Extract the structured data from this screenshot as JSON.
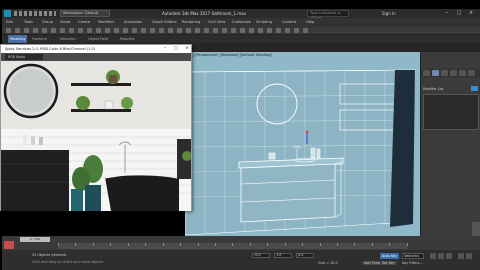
{
  "titlebar": {
    "workspace": "Workspace: Default",
    "app_title": "Autodesk 3ds Max 2017",
    "file_name": "bathroom_1.max",
    "search_placeholder": "Type a keyword or phrase",
    "signin": "Sign In"
  },
  "menubar": {
    "items": [
      "Edit",
      "Tools",
      "Group",
      "Views",
      "Create",
      "Modifiers",
      "Animation",
      "Graph Editors",
      "Rendering",
      "Civil View",
      "Customize",
      "Scripting",
      "Content",
      "Help"
    ]
  },
  "ribbon": {
    "tabs": [
      "Modeling",
      "Freeform",
      "Selection",
      "Object Paint",
      "Populate"
    ]
  },
  "image_window": {
    "title": "Spiky Services 2.0, RGB Color 8 Bits/Channel (1:2)",
    "channel_select": "RGB Alpha"
  },
  "viewport": {
    "label": "[+] [Perspective] [Standard] [Default Shading]"
  },
  "command_panel": {
    "modifier_list": "Modifier List"
  },
  "timeline": {
    "frame": "0 / 100",
    "tick_count": 21
  },
  "status": {
    "objects_selected": "23 Objects Selected",
    "prompt": "Click and drag to select and move objects",
    "x": "-0.0",
    "y": "1.0",
    "z": "0.0",
    "grid": "Grid = 10.0",
    "add_time_tag": "Add Time Tag",
    "auto_key": "Auto Key",
    "set_key": "Set Key",
    "selected": "Selected",
    "key_filters": "Key Filters..."
  },
  "colors": {
    "viewport_bg": "#8fb8c8",
    "wireframe": "#ffffff",
    "accent": "#3a8fd1"
  }
}
